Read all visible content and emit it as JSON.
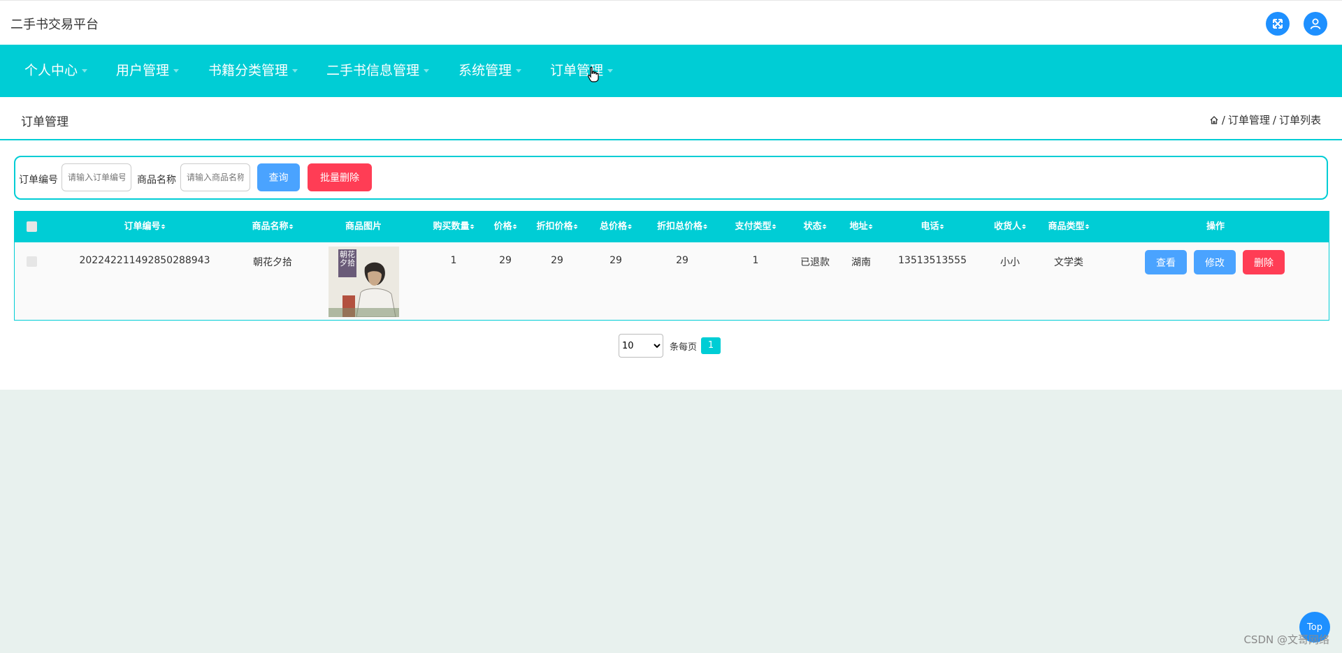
{
  "app": {
    "title": "二手书交易平台"
  },
  "colors": {
    "accent": "#00cdd5",
    "primary": "#4aa3ff",
    "danger": "#ff3d55",
    "icon_blue": "#1e90ff"
  },
  "header": {
    "icons": [
      "expand-icon",
      "user-icon"
    ]
  },
  "nav": {
    "items": [
      {
        "label": "个人中心"
      },
      {
        "label": "用户管理"
      },
      {
        "label": "书籍分类管理"
      },
      {
        "label": "二手书信息管理"
      },
      {
        "label": "系统管理"
      },
      {
        "label": "订单管理"
      }
    ]
  },
  "page": {
    "title": "订单管理",
    "breadcrumb": {
      "icon": "home-icon",
      "level1": "订单管理",
      "sep": "/",
      "level2": "订单列表"
    }
  },
  "search": {
    "order_no_label": "订单编号",
    "order_no_placeholder": "请输入订单编号",
    "product_name_label": "商品名称",
    "product_name_placeholder": "请输入商品名称",
    "query_button": "查询",
    "batch_delete_button": "批量删除"
  },
  "table": {
    "columns": [
      "订单编号",
      "商品名称",
      "商品图片",
      "购买数量",
      "价格",
      "折扣价格",
      "总价格",
      "折扣总价格",
      "支付类型",
      "状态",
      "地址",
      "电话",
      "收货人",
      "商品类型",
      "操作"
    ],
    "rows": [
      {
        "order_no": "202242211492850288943",
        "product_name": "朝花夕拾",
        "cover_title": "朝花夕拾",
        "quantity": "1",
        "price": "29",
        "discount_price": "29",
        "total_price": "29",
        "discount_total": "29",
        "pay_type": "1",
        "status": "已退款",
        "address": "湖南",
        "phone": "13513513555",
        "receiver": "小小",
        "product_type": "文学类",
        "actions": {
          "view": "查看",
          "edit": "修改",
          "delete": "删除"
        }
      }
    ]
  },
  "pagination": {
    "page_size": "10",
    "page_size_options": [
      "10"
    ],
    "per_page_label": "条每页",
    "current_page": "1"
  },
  "footer": {
    "top_button": "Top",
    "watermark": "CSDN @文哥网络"
  }
}
